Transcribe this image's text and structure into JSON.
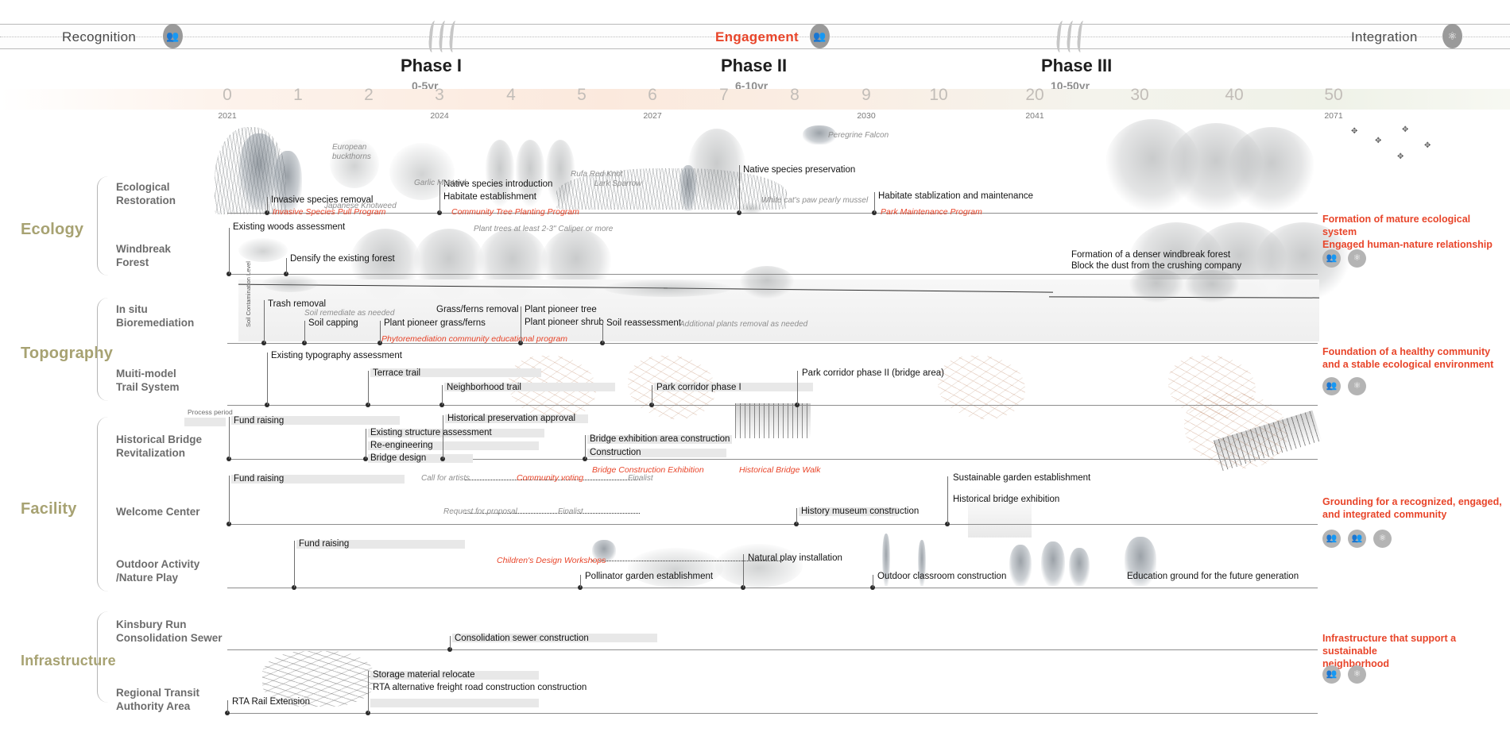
{
  "header": {
    "stages": [
      {
        "label": "Recognition",
        "icon": "people-icon",
        "accent": false
      },
      {
        "label": "Engagement",
        "icon": "people-icon",
        "accent": true
      },
      {
        "label": "Integration",
        "icon": "community-icon",
        "accent": false
      }
    ],
    "phases": [
      {
        "title": "Phase I",
        "sub": "0-5yr"
      },
      {
        "title": "Phase II",
        "sub": "6-10yr"
      },
      {
        "title": "Phase III",
        "sub": "10-50yr"
      }
    ]
  },
  "ruler": {
    "ticks": [
      "0",
      "1",
      "2",
      "3",
      "4",
      "5",
      "6",
      "7",
      "8",
      "9",
      "10",
      "20",
      "30",
      "40",
      "50"
    ],
    "years": [
      {
        "tick": "0",
        "label": "2021"
      },
      {
        "tick": "3",
        "label": "2024"
      },
      {
        "tick": "6",
        "label": "2027"
      },
      {
        "tick": "9",
        "label": "2030"
      },
      {
        "tick": "20",
        "label": "2041"
      },
      {
        "tick": "50",
        "label": "2071"
      }
    ]
  },
  "categories": [
    {
      "name": "Ecology"
    },
    {
      "name": "Topography"
    },
    {
      "name": "Facility"
    },
    {
      "name": "Infrastructure"
    }
  ],
  "rows": [
    {
      "label": "Ecological\nRestoration"
    },
    {
      "label": "Windbreak\nForest"
    },
    {
      "label": "In situ\nBioremediation"
    },
    {
      "label": "Muiti-model\nTrail System"
    },
    {
      "label": "Historical Bridge\nRevitalization"
    },
    {
      "label": "Welcome Center"
    },
    {
      "label": "Outdoor Activity\n/Nature Play"
    },
    {
      "label": "Kinsbury Run\nConsolidation Sewer"
    },
    {
      "label": "Regional Transit\nAuthority Area"
    }
  ],
  "events": {
    "ecological_restoration": [
      "Invasive species removal",
      "Native species introduction",
      "Habitate establishment",
      "Native species preservation",
      "Habitate stablization and maintenance"
    ],
    "ecological_restoration_programs": [
      "Invasive Species Pull Program",
      "Community Tree Planting Program",
      "Park Maintenance Program"
    ],
    "ecological_restoration_species": [
      "European buckthorns",
      "Garlic Mustard",
      "Japanese Knotweed",
      "Rufa Red Knot",
      "Lark Sparrow",
      "Peregrine Falcon",
      "White cat's paw pearly mussel"
    ],
    "windbreak_forest": [
      "Existing woods assessment",
      "Densify the existing forest",
      "Formation of a denser windbreak forest",
      "Block the dust from the crushing company"
    ],
    "windbreak_forest_notes": [
      "Plant trees at least 2-3\" Caliper or more"
    ],
    "bioremediation": [
      "Trash removal",
      "Soil capping",
      "Plant pioneer grass/ferns",
      "Grass/ferns removal",
      "Plant pioneer tree",
      "Plant pioneer shrub",
      "Soil reassessment"
    ],
    "bioremediation_notes": [
      "Soil remediate as needed",
      "Additional plants removal as needed",
      "Soil Contamination Level"
    ],
    "bioremediation_programs": [
      "Phytoremediation community educational program"
    ],
    "trail_system": [
      "Existing typography assessment",
      "Terrace trail",
      "Neighborhood trail",
      "Park corridor phase I",
      "Park corridor phase II (bridge area)"
    ],
    "historical_bridge": [
      "Process period",
      "Fund raising",
      "Existing structure assessment",
      "Re-engineering",
      "Bridge design",
      "Historical preservation approval",
      "Bridge exhibition area construction",
      "Construction"
    ],
    "historical_bridge_programs": [
      "Bridge Construction Exhibition",
      "Historical Bridge Walk"
    ],
    "welcome_center": [
      "Fund raising",
      "Sustainable garden establishment",
      "Historical bridge exhibition",
      "History museum construction"
    ],
    "welcome_center_notes": [
      "Call for artists",
      "Finalist",
      "Request for proposal",
      "Finalist"
    ],
    "welcome_center_programs": [
      "Community voting"
    ],
    "outdoor_activity": [
      "Fund raising",
      "Pollinator garden establishment",
      "Natural play installation",
      "Outdoor classroom construction",
      "Education ground for the future generation"
    ],
    "outdoor_activity_programs": [
      "Children's Design Workshops"
    ],
    "sewer": [
      "Consolidation sewer construction"
    ],
    "transit": [
      "RTA Rail Extension",
      "Storage material relocate",
      "RTA alternative freight road construction construction"
    ]
  },
  "outcomes": [
    {
      "text": "Formation of mature ecological system\nEngaged human-nature relationship",
      "badges": [
        "people-icon",
        "community-icon"
      ]
    },
    {
      "text": "Foundation of a healthy community\nand a stable ecological environment",
      "badges": [
        "people-icon",
        "community-icon"
      ]
    },
    {
      "text": "Grounding for a recognized, engaged,\nand integrated community",
      "badges": [
        "people-icon",
        "people-icon",
        "community-icon"
      ]
    },
    {
      "text": "Infrastructure that support a sustainable\nneighborhood",
      "badges": [
        "people-icon",
        "community-icon"
      ]
    }
  ],
  "colors": {
    "accent": "#e8452a",
    "category": "#a7a272",
    "bar": "#e8e8e8",
    "rule": "#8d8d8d"
  }
}
